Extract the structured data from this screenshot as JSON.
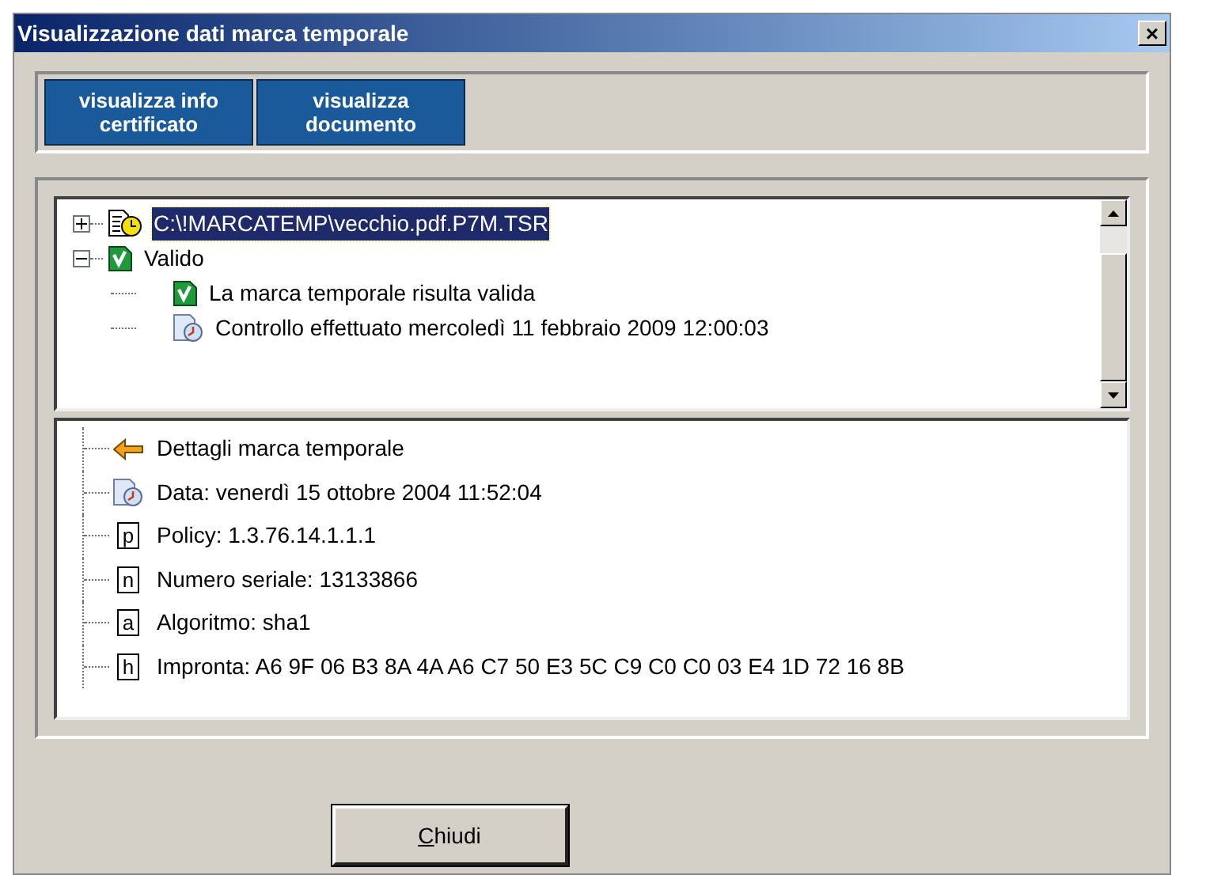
{
  "window": {
    "title": "Visualizzazione dati marca temporale",
    "close": "×"
  },
  "toolbar": [
    {
      "label": "visualizza info certificato"
    },
    {
      "label": "visualizza documento"
    }
  ],
  "tree": [
    {
      "label": "C:\\!MARCATEMP\\vecchio.pdf.P7M.TSR",
      "kind": "document-clock",
      "selected": true,
      "expanded": false
    },
    {
      "label": "Valido",
      "kind": "check",
      "selected": false,
      "expanded": true,
      "children": [
        {
          "label": "La marca temporale risulta valida",
          "kind": "check",
          "selected": false
        },
        {
          "label": "Controllo effettuato mercoledì 11 febbraio 2009  12:00:03",
          "kind": "clock",
          "selected": false
        }
      ]
    }
  ],
  "details": [
    {
      "label": "Dettagli marca temporale",
      "kind": "arrow"
    },
    {
      "label": "Data: venerdì 15 ottobre 2004  11:52:04",
      "kind": "clock"
    },
    {
      "label": "Policy: 1.3.76.14.1.1.1",
      "kind": "letter",
      "letter": "p"
    },
    {
      "label": "Numero seriale: 13133866",
      "kind": "letter",
      "letter": "n"
    },
    {
      "label": "Algoritmo: sha1",
      "kind": "letter",
      "letter": "a"
    },
    {
      "label": "Impronta: A6 9F 06 B3 8A 4A A6 C7 50 E3 5C C9 C0 C0 03 E4 1D 72 16 8B",
      "kind": "letter",
      "letter": "h"
    }
  ],
  "close_button": {
    "label": "Chiudi",
    "underline_first": true
  }
}
